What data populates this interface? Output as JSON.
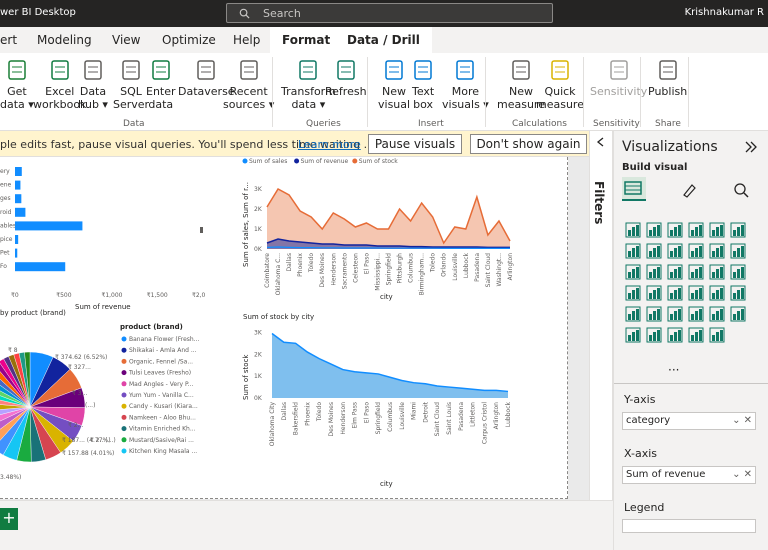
{
  "app": {
    "title": "wer BI Desktop",
    "search_placeholder": "Search",
    "user": "Krishnakumar R"
  },
  "menu": {
    "tabs": [
      "ert",
      "Modeling",
      "View",
      "Optimize",
      "Help"
    ],
    "active1": "Format",
    "active2": "Data / Drill"
  },
  "ribbon": {
    "buttons": [
      {
        "l1": "Get",
        "l2": "data ▾",
        "x": 0
      },
      {
        "l1": "Excel",
        "l2": "workbook",
        "x": 33
      },
      {
        "l1": "Data",
        "l2": "hub ▾",
        "x": 78
      },
      {
        "l1": "SQL",
        "l2": "Server",
        "x": 113
      },
      {
        "l1": "Enter",
        "l2": "data",
        "x": 146
      },
      {
        "l1": "Dataverse",
        "l2": "",
        "x": 178
      },
      {
        "l1": "Recent",
        "l2": "sources ▾",
        "x": 223
      },
      {
        "l1": "Transform",
        "l2": "data ▾",
        "x": 281
      },
      {
        "l1": "Refresh",
        "l2": "",
        "x": 325
      },
      {
        "l1": "New",
        "l2": "visual",
        "x": 378
      },
      {
        "l1": "Text",
        "l2": "box",
        "x": 412
      },
      {
        "l1": "More",
        "l2": "visuals ▾",
        "x": 442
      },
      {
        "l1": "New",
        "l2": "measure",
        "x": 497
      },
      {
        "l1": "Quick",
        "l2": "measure",
        "x": 536
      },
      {
        "l1": "Sensitivity",
        "l2": "",
        "x": 590
      },
      {
        "l1": "Publish",
        "l2": "",
        "x": 648
      }
    ],
    "groups": [
      {
        "label": "Data",
        "x": 123
      },
      {
        "label": "Queries",
        "x": 306
      },
      {
        "label": "Insert",
        "x": 418
      },
      {
        "label": "Calculations",
        "x": 512
      },
      {
        "label": "Sensitivity",
        "x": 593
      },
      {
        "label": "Share",
        "x": 655
      }
    ]
  },
  "notice": {
    "message": "ple edits fast, pause visual queries. You'll spend less time waiting ...",
    "learn_more": "Learn more",
    "pause": "Pause visuals",
    "dont_show": "Don't show again"
  },
  "filters": {
    "label": "Filters"
  },
  "viz": {
    "title": "Visualizations",
    "subtitle": "Build visual",
    "yaxis_label": "Y-axis",
    "yaxis_value": "category",
    "xaxis_label": "X-axis",
    "xaxis_value": "Sum of revenue",
    "legend_label": "Legend"
  },
  "charts": {
    "bar": {
      "categories": [
        "ery",
        "ene",
        "ges",
        "roid",
        "ables",
        "pice",
        "Pet",
        "Fo"
      ],
      "values": [
        75,
        60,
        70,
        115,
        745,
        35,
        25,
        555
      ],
      "xticks": [
        "₹0",
        "₹500",
        "₹1,000",
        "₹1,500",
        "₹2,000"
      ],
      "xlabel": "Sum of revenue",
      "xmax": 2000
    },
    "line": {
      "legend": [
        "Sum of sales",
        "Sum of revenue",
        "Sum of stock"
      ],
      "legend_colors": [
        "#118dff",
        "#12239e",
        "#e66c37"
      ],
      "yticks": [
        "0K",
        "1K",
        "2K",
        "3K"
      ],
      "ylabel": "Sum of sales, Sum of r...",
      "xlabel": "city",
      "cities": [
        "Coimbatore",
        "Oklahoma C...",
        "Dallas",
        "Phoenix",
        "Toledo",
        "Des Moines",
        "Henderson",
        "Sacramento",
        "Celesteon",
        "El Paso",
        "Mississippi...",
        "Springfield",
        "Pittsburgh",
        "Columbus",
        "Birmingham...",
        "Toledo",
        "Orlando",
        "Louisville",
        "Lubbock",
        "Pasadena",
        "Saint Cloud",
        "Washingt...",
        "Arlington"
      ],
      "stock": [
        2.1,
        3.0,
        2.7,
        1.9,
        1.6,
        1.0,
        1.8,
        1.5,
        1.1,
        1.3,
        1.0,
        1.0,
        2.0,
        1.4,
        2.3,
        1.6,
        0.3,
        1.1,
        1.0,
        2.6,
        0.7,
        1.4,
        0.4
      ],
      "revenue": [
        0.3,
        0.5,
        0.4,
        0.35,
        0.3,
        0.25,
        0.25,
        0.2,
        0.2,
        0.2,
        0.15,
        0.15,
        0.15,
        0.12,
        0.12,
        0.1,
        0.1,
        0.1,
        0.1,
        0.1,
        0.08,
        0.08,
        0.08
      ],
      "sales": [
        0.08,
        0.1,
        0.08,
        0.07,
        0.07,
        0.06,
        0.06,
        0.05,
        0.05,
        0.05,
        0.05,
        0.04,
        0.04,
        0.04,
        0.04,
        0.04,
        0.03,
        0.03,
        0.03,
        0.03,
        0.03,
        0.03,
        0.03
      ],
      "ymax": 3.5
    },
    "area": {
      "title": "Sum of stock by city",
      "yticks": [
        "0K",
        "1K",
        "2K",
        "3K"
      ],
      "ylabel": "Sum of stock",
      "xlabel": "city",
      "cities": [
        "Oklahoma City",
        "Dallas",
        "Bakersfield",
        "Phoenix",
        "Toledo",
        "Des Moines",
        "Henderson",
        "Elm Pass",
        "El Paso",
        "Springfield",
        "Columbus",
        "Louisville",
        "Miami",
        "Detroit",
        "Saint Cloud",
        "Saint Louis",
        "Pasadena",
        "Littleton",
        "Carpus Cristol",
        "Arlington",
        "Lubbock"
      ],
      "values": [
        2.95,
        2.55,
        2.5,
        2.1,
        1.8,
        1.55,
        1.3,
        1.2,
        1.15,
        1.1,
        0.95,
        0.8,
        0.7,
        0.65,
        0.55,
        0.5,
        0.45,
        0.4,
        0.35,
        0.35,
        0.3
      ],
      "ymax": 3.2
    },
    "pie": {
      "title": "by product (brand)",
      "legend_title": "product (brand)",
      "items": [
        {
          "name": "Banana Flower (Fresh...",
          "color": "#118dff"
        },
        {
          "name": "Shikakai - Amla And ...",
          "color": "#12239e"
        },
        {
          "name": "Organic, Fennel /Sa...",
          "color": "#e66c37"
        },
        {
          "name": "Tulsi Leaves (Fresho)",
          "color": "#6b007b"
        },
        {
          "name": "Mad Angles - Very P...",
          "color": "#e044a7"
        },
        {
          "name": "Yum Yum - Vanilla C...",
          "color": "#744ec2"
        },
        {
          "name": "Candy - Kusari (Kiara...",
          "color": "#d9b300"
        },
        {
          "name": "Namkeen - Aloo Bhu...",
          "color": "#d64550"
        },
        {
          "name": "Vitamin Enriched Kh...",
          "color": "#197278"
        },
        {
          "name": "Mustard/Sasive/Rai ...",
          "color": "#1aab40"
        },
        {
          "name": "Kitchen King Masala ...",
          "color": "#15c6f4"
        }
      ],
      "labels": [
        "₹ 8",
        "₹ 374.62 (6.52%)",
        "₹ 327...",
        "₹ 3...",
        "₹ 2...",
        "₹ 187... (4.77%)",
        "₹ 157.88 (4.01%)",
        "3.48%)",
        "(...)",
        "₹ 2.. (...)"
      ]
    }
  }
}
